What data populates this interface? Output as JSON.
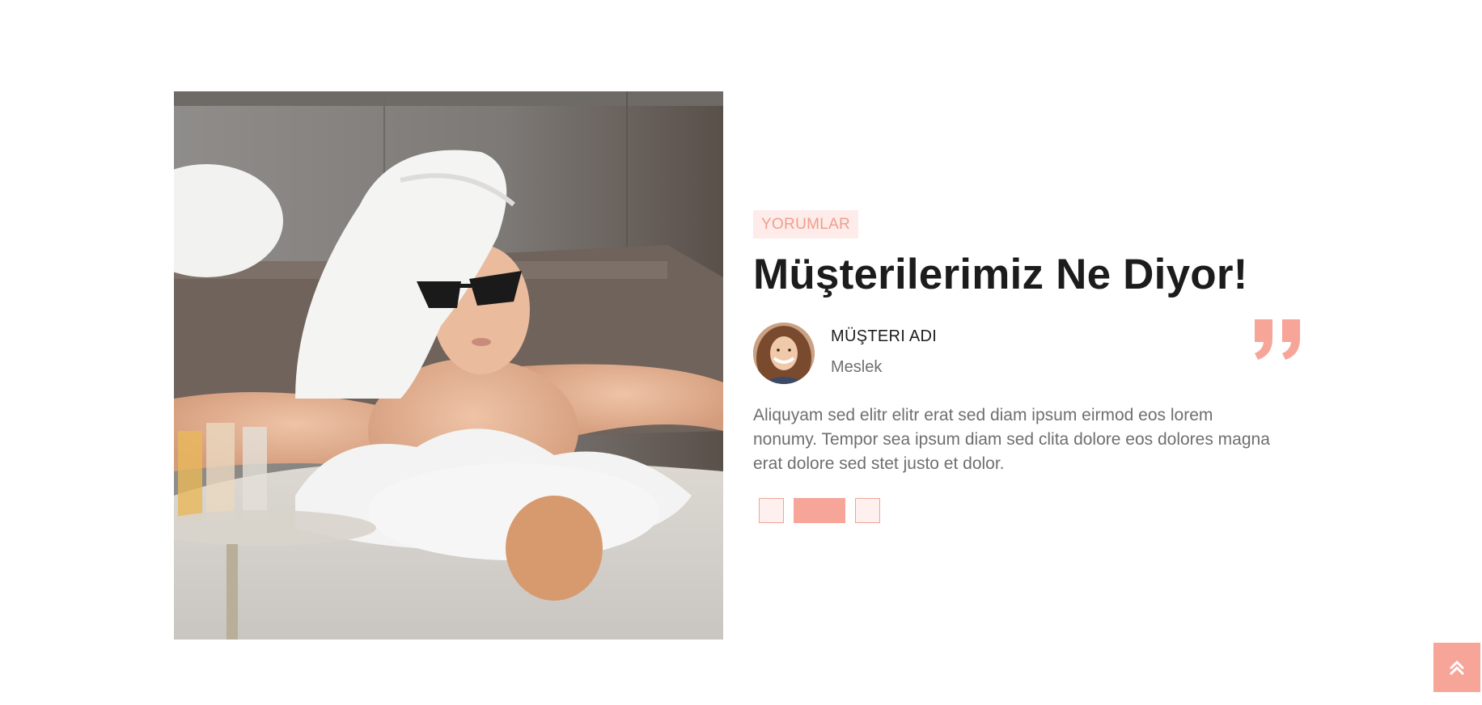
{
  "testimonial": {
    "tag": "YORUMLAR",
    "heading": "Müşterilerimiz Ne Diyor!",
    "author_name": "MÜŞTERI ADI",
    "author_job": "Meslek",
    "text": "Aliquyam sed elitr elitr erat sed diam ipsum eirmod eos lorem nonumy. Tempor sea ipsum diam sed clita dolore eos dolores magna erat dolore sed stet justo et dolor.",
    "quote_icon": "quote-right-icon",
    "pagination": {
      "count": 3,
      "active_index": 1
    }
  },
  "photo": {
    "subject": "woman-in-bathtub-photo"
  },
  "back_to_top": {
    "icon": "double-chevron-up-icon"
  },
  "colors": {
    "accent": "#f7a598",
    "tag_bg": "#fdecea",
    "heading": "#1c1c1c",
    "body_text": "#6f6f6f"
  }
}
